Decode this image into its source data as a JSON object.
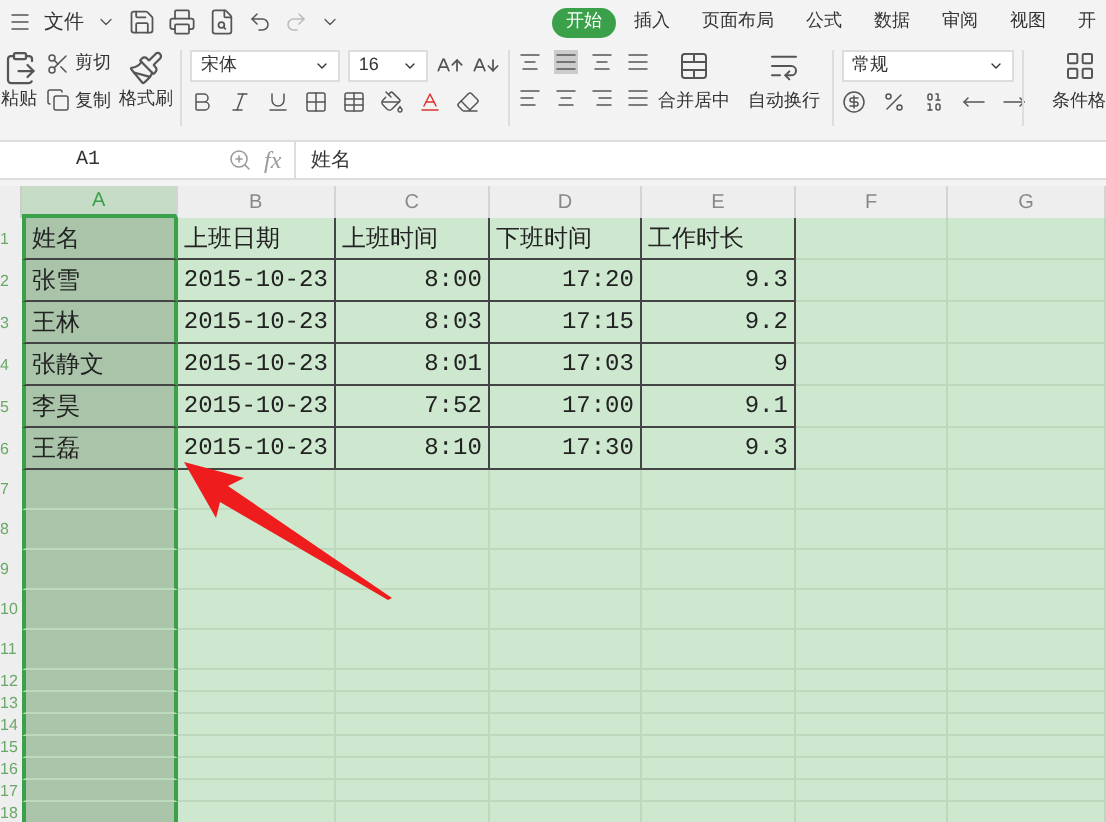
{
  "menu": {
    "file_label": "文件",
    "tabs": [
      {
        "label": "开始",
        "selected": true
      },
      {
        "label": "插入",
        "selected": false
      },
      {
        "label": "页面布局",
        "selected": false
      },
      {
        "label": "公式",
        "selected": false
      },
      {
        "label": "数据",
        "selected": false
      },
      {
        "label": "审阅",
        "selected": false
      },
      {
        "label": "视图",
        "selected": false
      },
      {
        "label": "开",
        "selected": false
      }
    ]
  },
  "ribbon": {
    "paste": "粘贴",
    "cut": "剪切",
    "copy": "复制",
    "format_painter": "格式刷",
    "font_name": "宋体",
    "font_size": "16",
    "merge": "合并居中",
    "wrap": "自动换行",
    "number_format": "常规",
    "conditional_format": "条件格"
  },
  "formula_bar": {
    "name_box": "A1",
    "fx_label": "fx",
    "value": "姓名"
  },
  "sheet": {
    "columns": [
      {
        "label": "A",
        "selected": true
      },
      {
        "label": "B",
        "selected": false
      },
      {
        "label": "C",
        "selected": false
      },
      {
        "label": "D",
        "selected": false
      },
      {
        "label": "E",
        "selected": false
      },
      {
        "label": "F",
        "selected": false
      },
      {
        "label": "G",
        "selected": false
      }
    ],
    "rows": [
      {
        "number": "1",
        "cells": [
          {
            "text": "姓名",
            "kind": "text"
          },
          {
            "text": "上班日期",
            "kind": "text"
          },
          {
            "text": "上班时间",
            "kind": "text"
          },
          {
            "text": "下班时间",
            "kind": "text"
          },
          {
            "text": "工作时长",
            "kind": "text"
          }
        ]
      },
      {
        "number": "2",
        "cells": [
          {
            "text": "张雪",
            "kind": "text"
          },
          {
            "text": "2015-10-23",
            "kind": "number"
          },
          {
            "text": "8:00",
            "kind": "number"
          },
          {
            "text": "17:20",
            "kind": "number"
          },
          {
            "text": "9.3",
            "kind": "number"
          }
        ]
      },
      {
        "number": "3",
        "cells": [
          {
            "text": "王林",
            "kind": "text"
          },
          {
            "text": "2015-10-23",
            "kind": "number"
          },
          {
            "text": "8:03",
            "kind": "number"
          },
          {
            "text": "17:15",
            "kind": "number"
          },
          {
            "text": "9.2",
            "kind": "number"
          }
        ]
      },
      {
        "number": "4",
        "cells": [
          {
            "text": "张静文",
            "kind": "text"
          },
          {
            "text": "2015-10-23",
            "kind": "number"
          },
          {
            "text": "8:01",
            "kind": "number"
          },
          {
            "text": "17:03",
            "kind": "number"
          },
          {
            "text": "9",
            "kind": "number"
          }
        ]
      },
      {
        "number": "5",
        "cells": [
          {
            "text": "李昊",
            "kind": "text"
          },
          {
            "text": "2015-10-23",
            "kind": "number"
          },
          {
            "text": "7:52",
            "kind": "number"
          },
          {
            "text": "17:00",
            "kind": "number"
          },
          {
            "text": "9.1",
            "kind": "number"
          }
        ]
      },
      {
        "number": "6",
        "cells": [
          {
            "text": "王磊",
            "kind": "text"
          },
          {
            "text": "2015-10-23",
            "kind": "number"
          },
          {
            "text": "8:10",
            "kind": "number"
          },
          {
            "text": "17:30",
            "kind": "number"
          },
          {
            "text": "9.3",
            "kind": "number"
          }
        ]
      },
      {
        "number": "7"
      },
      {
        "number": "8"
      },
      {
        "number": "9"
      },
      {
        "number": "10"
      },
      {
        "number": "11"
      },
      {
        "number": "12"
      },
      {
        "number": "13"
      },
      {
        "number": "14"
      },
      {
        "number": "15"
      },
      {
        "number": "16"
      },
      {
        "number": "17"
      },
      {
        "number": "18"
      }
    ]
  }
}
